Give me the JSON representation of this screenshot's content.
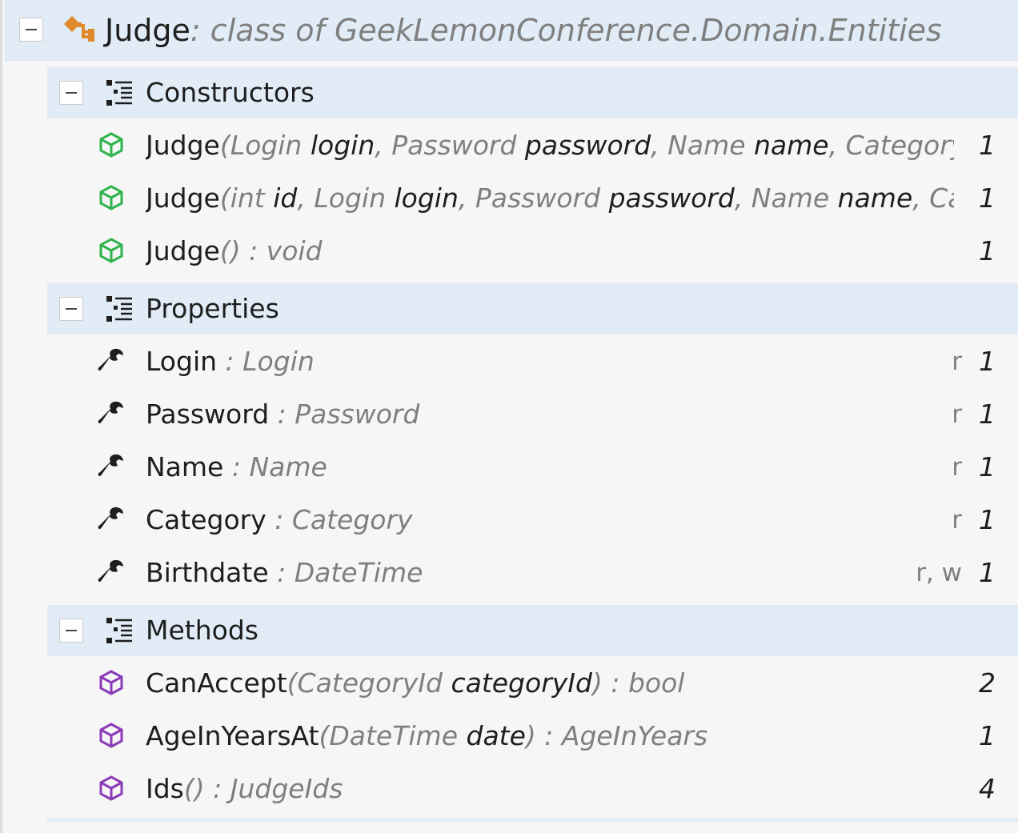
{
  "class": {
    "name": "Judge",
    "kind": ": class",
    "ns_prefix": " of ",
    "namespace": "GeekLemonConference.Domain.Entities"
  },
  "groups": {
    "constructors": {
      "label": "Constructors",
      "items": [
        {
          "name": "Judge",
          "open": "(",
          "params": [
            {
              "type": "Login",
              "name": "login"
            },
            {
              "type": "Password",
              "name": "password"
            },
            {
              "type": "Name",
              "name": "name"
            }
          ],
          "tail": ", Category...",
          "close": "",
          "ret": "",
          "count": "1"
        },
        {
          "name": "Judge",
          "open": "(",
          "params": [
            {
              "type": "int",
              "name": "id"
            },
            {
              "type": "Login",
              "name": "login"
            },
            {
              "type": "Password",
              "name": "password"
            },
            {
              "type": "Name",
              "name": "name"
            }
          ],
          "tail": ", Ca...",
          "close": "",
          "ret": "",
          "count": "1"
        },
        {
          "name": "Judge",
          "open": "()",
          "params": [],
          "tail": "",
          "close": "",
          "ret": " : void",
          "count": "1"
        }
      ]
    },
    "properties": {
      "label": "Properties",
      "items": [
        {
          "name": "Login",
          "type": " : Login",
          "access": "r",
          "count": "1"
        },
        {
          "name": "Password",
          "type": " : Password",
          "access": "r",
          "count": "1"
        },
        {
          "name": "Name",
          "type": " : Name",
          "access": "r",
          "count": "1"
        },
        {
          "name": "Category",
          "type": " : Category",
          "access": "r",
          "count": "1"
        },
        {
          "name": "Birthdate",
          "type": " : DateTime",
          "access": "r, w",
          "count": "1"
        }
      ]
    },
    "methods": {
      "label": "Methods",
      "items": [
        {
          "name": "CanAccept",
          "open": "(",
          "params": [
            {
              "type": "CategoryId",
              "name": "categoryId"
            }
          ],
          "tail": "",
          "close": ")",
          "ret": " : bool",
          "count": "2"
        },
        {
          "name": "AgeInYearsAt",
          "open": "(",
          "params": [
            {
              "type": "DateTime",
              "name": "date"
            }
          ],
          "tail": "",
          "close": ")",
          "ret": " : AgeInYears",
          "count": "1"
        },
        {
          "name": "Ids",
          "open": "()",
          "params": [],
          "tail": "",
          "close": "",
          "ret": " : JudgeIds",
          "count": "4"
        }
      ]
    }
  },
  "colors": {
    "constructor_icon": "#2fb34a",
    "method_icon": "#8b3ab8",
    "class_icon": "#e08a2c",
    "header_bg": "#e1ecf6"
  },
  "icons": {
    "class": "class-icon",
    "group": "member-group-icon",
    "constructor": "constructor-cube-icon",
    "property": "wrench-icon",
    "method": "method-cube-icon"
  }
}
